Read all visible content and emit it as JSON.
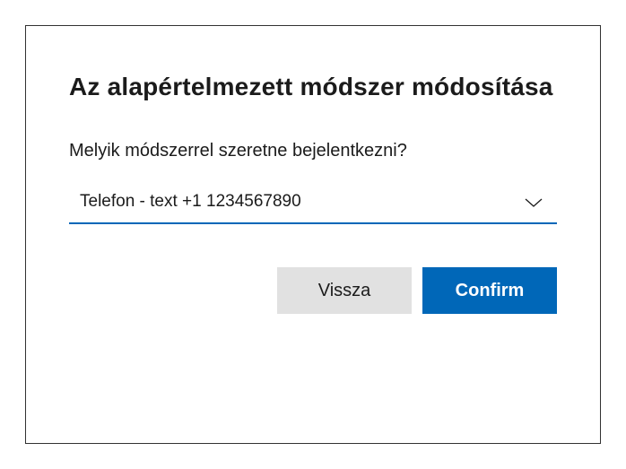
{
  "dialog": {
    "title": "Az alapértelmezett módszer módosítása",
    "question": "Melyik módszerrel szeretne bejelentkezni?",
    "select": {
      "value": "Telefon - text +1 1234567890"
    },
    "buttons": {
      "back": "Vissza",
      "confirm": "Confirm"
    }
  },
  "colors": {
    "accent": "#0067b8",
    "secondary_button": "#e1e1e1"
  }
}
